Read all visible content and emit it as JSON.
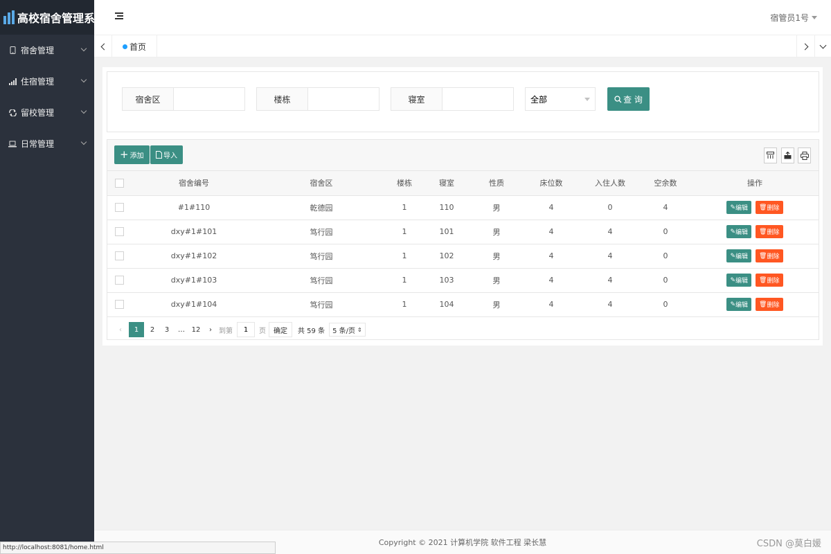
{
  "app": {
    "logo_text": "高校宿舍管理系统"
  },
  "sidebar": {
    "items": [
      {
        "label": "宿舍管理",
        "icon": "phone-icon"
      },
      {
        "label": "住宿管理",
        "icon": "signal-icon"
      },
      {
        "label": "留校管理",
        "icon": "refresh-icon"
      },
      {
        "label": "日常管理",
        "icon": "laptop-icon"
      }
    ]
  },
  "header": {
    "user_name": "宿管员1号"
  },
  "tabs": {
    "home_label": "首页"
  },
  "search": {
    "area_label": "宿舍区",
    "building_label": "楼栋",
    "room_label": "寝室",
    "select_value": "全部",
    "query_label": "查 询"
  },
  "toolbar": {
    "add_label": "添加",
    "import_label": "导入"
  },
  "table": {
    "headers": [
      "宿舍编号",
      "宿舍区",
      "楼栋",
      "寝室",
      "性质",
      "床位数",
      "入住人数",
      "空余数",
      "操作"
    ],
    "edit_label": "编辑",
    "delete_label": "删除",
    "rows": [
      [
        "#1#110",
        "乾德园",
        "1",
        "110",
        "男",
        "4",
        "0",
        "4"
      ],
      [
        "dxy#1#101",
        "笃行园",
        "1",
        "101",
        "男",
        "4",
        "4",
        "0"
      ],
      [
        "dxy#1#102",
        "笃行园",
        "1",
        "102",
        "男",
        "4",
        "4",
        "0"
      ],
      [
        "dxy#1#103",
        "笃行园",
        "1",
        "103",
        "男",
        "4",
        "4",
        "0"
      ],
      [
        "dxy#1#104",
        "笃行园",
        "1",
        "104",
        "男",
        "4",
        "4",
        "0"
      ]
    ]
  },
  "pager": {
    "pages": [
      "1",
      "2",
      "3"
    ],
    "ellipsis": "…",
    "last": "12",
    "goto_label": "到第",
    "goto_value": "1",
    "page_unit": "页",
    "confirm_label": "确定",
    "total_label": "共 59 条",
    "limit_label": "5 条/页"
  },
  "footer": {
    "copyright": "Copyright © 2021 计算机学院 软件工程 梁长慧"
  },
  "statusbar": {
    "url": "http://localhost:8081/home.html"
  },
  "watermark": "CSDN @莫白媛",
  "colors": {
    "sidebar_bg": "#2b313c",
    "accent": "#3b8f84",
    "danger": "#ff5722"
  }
}
